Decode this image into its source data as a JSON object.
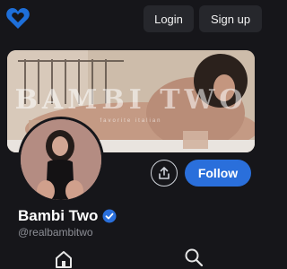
{
  "header": {
    "logo_icon": "heart-logo-icon",
    "login_label": "Login",
    "signup_label": "Sign up"
  },
  "banner": {
    "title": "BAMBI TWO",
    "subtitle": "favorite italian"
  },
  "profile": {
    "display_name": "Bambi Two",
    "handle": "@realbambitwo",
    "verified_icon": "verified-badge-icon",
    "follow_label": "Follow",
    "share_icon": "share-icon"
  },
  "nav": {
    "items": [
      {
        "icon": "home-icon"
      },
      {
        "icon": "search-icon"
      }
    ]
  },
  "colors": {
    "background": "#16161a",
    "accent": "#2a6fdb",
    "muted_text": "#8d8f96"
  }
}
